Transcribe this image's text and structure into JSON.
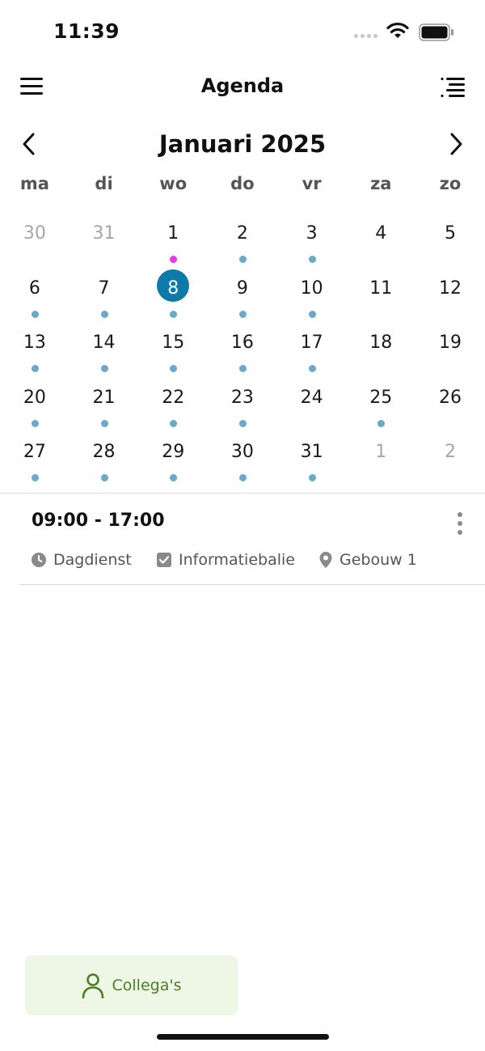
{
  "status": {
    "time": "11:39"
  },
  "header": {
    "title": "Agenda"
  },
  "calendar": {
    "month_title": "Januari 2025",
    "weekdays": [
      "ma",
      "di",
      "wo",
      "do",
      "vr",
      "za",
      "zo"
    ],
    "weeks": [
      [
        {
          "n": "30",
          "muted": true,
          "dot": null
        },
        {
          "n": "31",
          "muted": true,
          "dot": null
        },
        {
          "n": "1",
          "dot": "pink"
        },
        {
          "n": "2",
          "dot": "blue"
        },
        {
          "n": "3",
          "dot": "blue"
        },
        {
          "n": "4",
          "dot": null
        },
        {
          "n": "5",
          "dot": null
        }
      ],
      [
        {
          "n": "6",
          "dot": "blue"
        },
        {
          "n": "7",
          "dot": "blue"
        },
        {
          "n": "8",
          "dot": "blue",
          "selected": true
        },
        {
          "n": "9",
          "dot": "blue"
        },
        {
          "n": "10",
          "dot": "blue"
        },
        {
          "n": "11",
          "dot": null
        },
        {
          "n": "12",
          "dot": null
        }
      ],
      [
        {
          "n": "13",
          "dot": "blue"
        },
        {
          "n": "14",
          "dot": "blue"
        },
        {
          "n": "15",
          "dot": "blue"
        },
        {
          "n": "16",
          "dot": "blue"
        },
        {
          "n": "17",
          "dot": "blue"
        },
        {
          "n": "18",
          "dot": null
        },
        {
          "n": "19",
          "dot": null
        }
      ],
      [
        {
          "n": "20",
          "dot": "blue"
        },
        {
          "n": "21",
          "dot": "blue"
        },
        {
          "n": "22",
          "dot": "blue"
        },
        {
          "n": "23",
          "dot": "blue"
        },
        {
          "n": "24",
          "dot": null
        },
        {
          "n": "25",
          "dot": "blue"
        },
        {
          "n": "26",
          "dot": null
        }
      ],
      [
        {
          "n": "27",
          "dot": "blue"
        },
        {
          "n": "28",
          "dot": "blue"
        },
        {
          "n": "29",
          "dot": "blue"
        },
        {
          "n": "30",
          "dot": "blue"
        },
        {
          "n": "31",
          "dot": "blue"
        },
        {
          "n": "1",
          "muted": true,
          "dot": null
        },
        {
          "n": "2",
          "muted": true,
          "dot": null
        }
      ]
    ],
    "colors": {
      "selected": "#0d7aa8",
      "dot_blue": "#6aa9c7",
      "dot_pink": "#e63be0"
    }
  },
  "event": {
    "time": "09:00 - 17:00",
    "shift": "Dagdienst",
    "task": "Informatiebalie",
    "location": "Gebouw 1"
  },
  "bottom": {
    "colleagues_label": "Collega's",
    "accent": "#4e7d25"
  }
}
